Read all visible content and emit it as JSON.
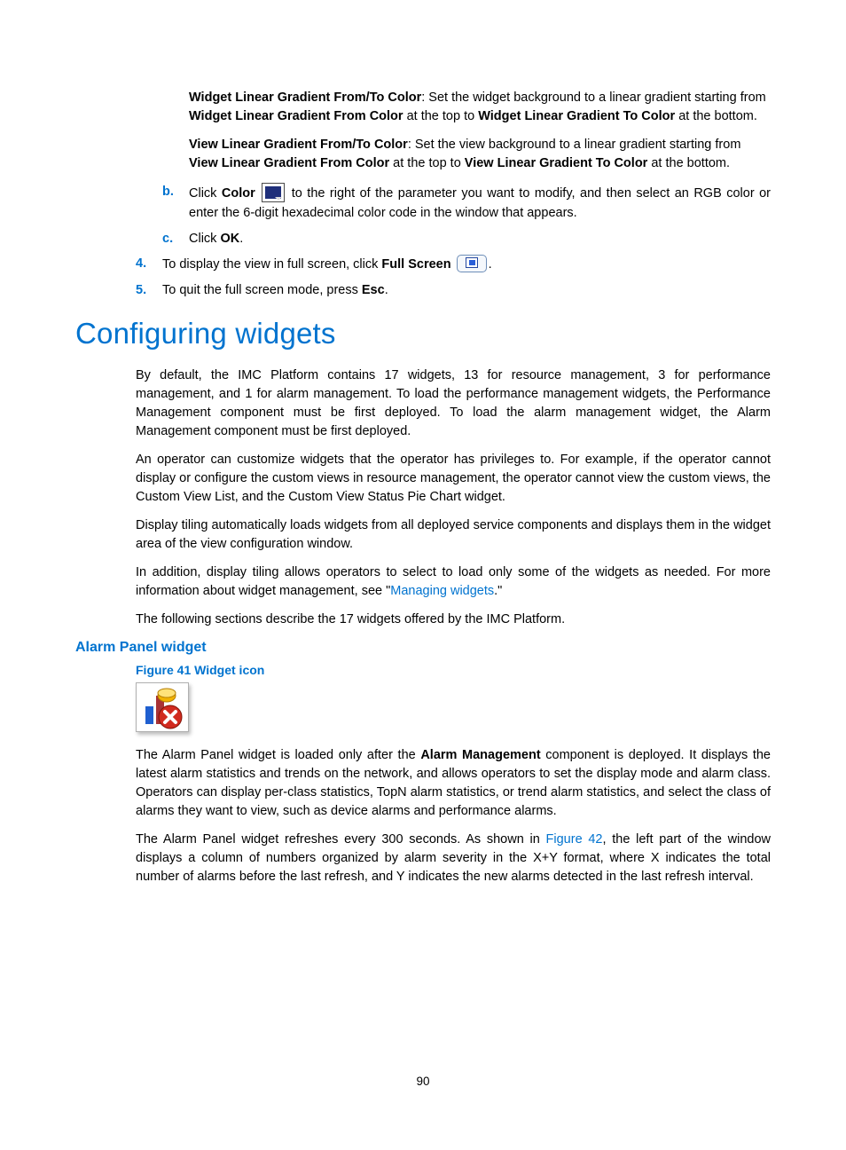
{
  "para1": {
    "b1": "Widget Linear Gradient From/To Color",
    "t1": ": Set the widget background to a linear gradient starting from ",
    "b2": "Widget Linear Gradient From Color",
    "t2": " at the top to ",
    "b3": "Widget Linear Gradient To Color",
    "t3": " at the bottom."
  },
  "para2": {
    "b1": "View Linear Gradient From/To Color",
    "t1": ": Set the view background to a linear gradient starting from ",
    "b2": "View Linear Gradient From Color",
    "t2": " at the top to ",
    "b3": "View Linear Gradient To Color",
    "t3": " at the bottom."
  },
  "step_b": {
    "marker": "b.",
    "t1": "Click ",
    "bold1": "Color",
    "t2": " to the right of the parameter you want to modify, and then select an RGB color or enter the 6-digit hexadecimal color code in the window that appears."
  },
  "step_c": {
    "marker": "c.",
    "t1": "Click ",
    "bold1": "OK",
    "t2": "."
  },
  "step_4": {
    "marker": "4.",
    "t1": "To display the view in full screen, click ",
    "bold1": "Full Screen",
    "t2": "."
  },
  "step_5": {
    "marker": "5.",
    "t1": "To quit the full screen mode, press ",
    "bold1": "Esc",
    "t2": "."
  },
  "h2": "Configuring widgets",
  "cw_p1": "By default, the IMC Platform contains 17 widgets, 13 for resource management, 3 for performance management, and 1 for alarm management. To load the performance management widgets, the Performance Management component must be first deployed. To load the alarm management widget, the Alarm Management component must be first deployed.",
  "cw_p2": "An operator can customize widgets that the operator has privileges to. For example, if the operator cannot display or configure the custom views in resource management, the operator cannot view the custom views, the Custom View List, and the Custom View Status Pie Chart widget.",
  "cw_p3": "Display tiling automatically loads widgets from all deployed service components and displays them in the widget area of the view configuration window.",
  "cw_p4a": "In addition, display tiling allows operators to select to load only some of the widgets as needed. For more information about widget management, see \"",
  "cw_p4_link": "Managing widgets",
  "cw_p4b": ".\"",
  "cw_p5": "The following sections describe the 17 widgets offered by the IMC Platform.",
  "h3": "Alarm Panel widget",
  "fig_caption": "Figure 41 Widget icon",
  "ap_p1a": "The Alarm Panel widget is loaded only after the ",
  "ap_p1_bold": "Alarm Management",
  "ap_p1b": " component is deployed. It displays the latest alarm statistics and trends on the network, and allows operators to set the display mode and alarm class. Operators can display per-class statistics, TopN alarm statistics, or trend alarm statistics, and select the class of alarms they want to view, such as device alarms and performance alarms.",
  "ap_p2a": "The Alarm Panel widget refreshes every 300 seconds. As shown in ",
  "ap_p2_link": "Figure 42",
  "ap_p2b": ", the left part of the window displays a column of numbers organized by alarm severity in the X+Y format, where X indicates the total number of alarms before the last refresh, and Y indicates the new alarms detected in the last refresh interval.",
  "page_number": "90"
}
